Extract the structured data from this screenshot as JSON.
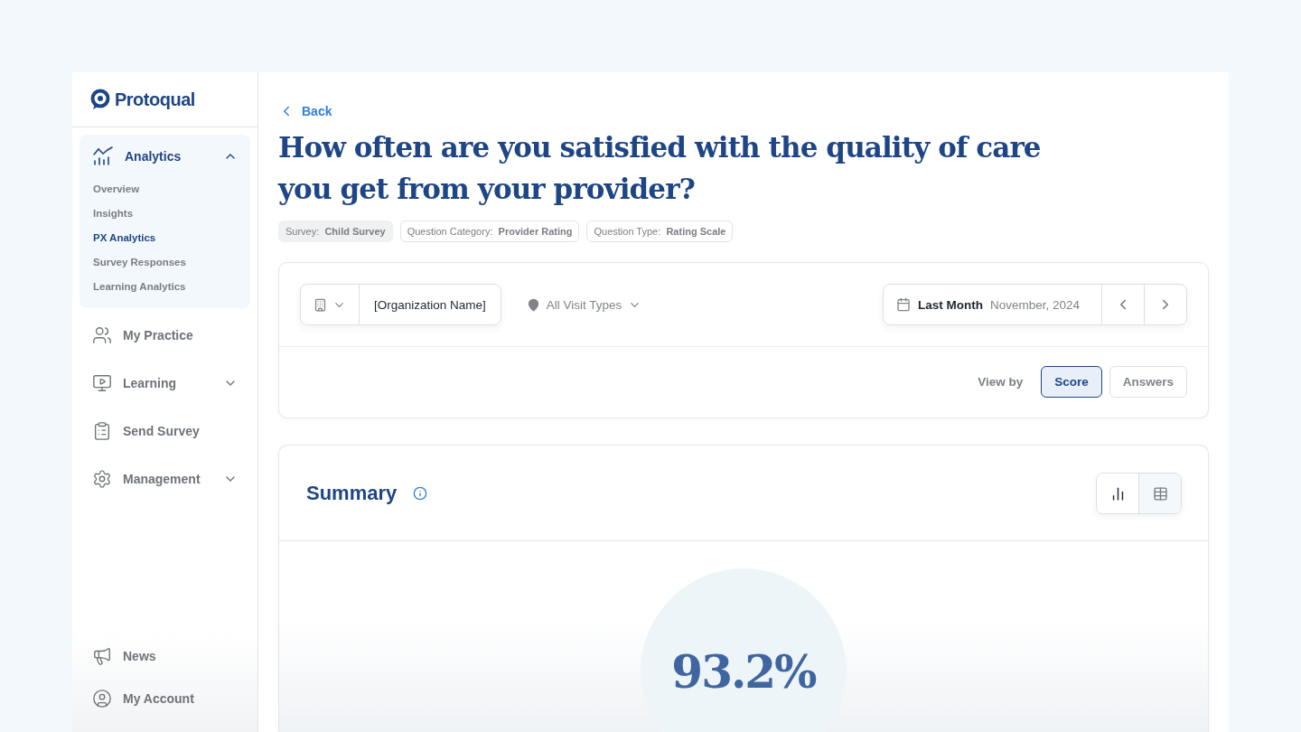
{
  "logo": {
    "text": "Protoqual"
  },
  "sidebar": {
    "items": [
      {
        "kind": "group",
        "label": "Analytics",
        "expanded": true,
        "active": true,
        "children": [
          {
            "label": "Overview",
            "selected": false
          },
          {
            "label": "Insights",
            "selected": false
          },
          {
            "label": "PX Analytics",
            "selected": true
          },
          {
            "label": "Survey Responses",
            "selected": false
          },
          {
            "label": "Learning Analytics",
            "selected": false
          }
        ]
      },
      {
        "kind": "link",
        "label": "My Practice",
        "active": false
      },
      {
        "kind": "group",
        "label": "Learning",
        "expanded": false,
        "active": false
      },
      {
        "kind": "link",
        "label": "Send Survey",
        "active": false
      },
      {
        "kind": "group",
        "label": "Management",
        "expanded": false,
        "active": false
      }
    ],
    "footer_items": [
      {
        "label": "News"
      },
      {
        "label": "My Account"
      }
    ]
  },
  "back": {
    "label": "Back"
  },
  "question": {
    "title": "How often are you satisfied with the quality of care you get from your provider?"
  },
  "chips": [
    {
      "kind": "filled",
      "label": "Survey:",
      "value": "Child Survey"
    },
    {
      "kind": "outlined",
      "label": "Question Category:",
      "value": "Provider Rating"
    },
    {
      "kind": "outlined",
      "label": "Question Type:",
      "value": "Rating Scale"
    }
  ],
  "filters": {
    "organization": "[Organization Name]",
    "visit_type": "All Visit Types",
    "period_label": "Last Month",
    "period_value": "November, 2024"
  },
  "view_by": {
    "label": "View by",
    "options": [
      {
        "label": "Score",
        "selected": true
      },
      {
        "label": "Answers",
        "selected": false
      }
    ]
  },
  "summary": {
    "title": "Summary",
    "view_toggles": [
      {
        "kind": "chart",
        "selected": true
      },
      {
        "kind": "table",
        "selected": false
      }
    ],
    "score": "93.2%"
  }
}
